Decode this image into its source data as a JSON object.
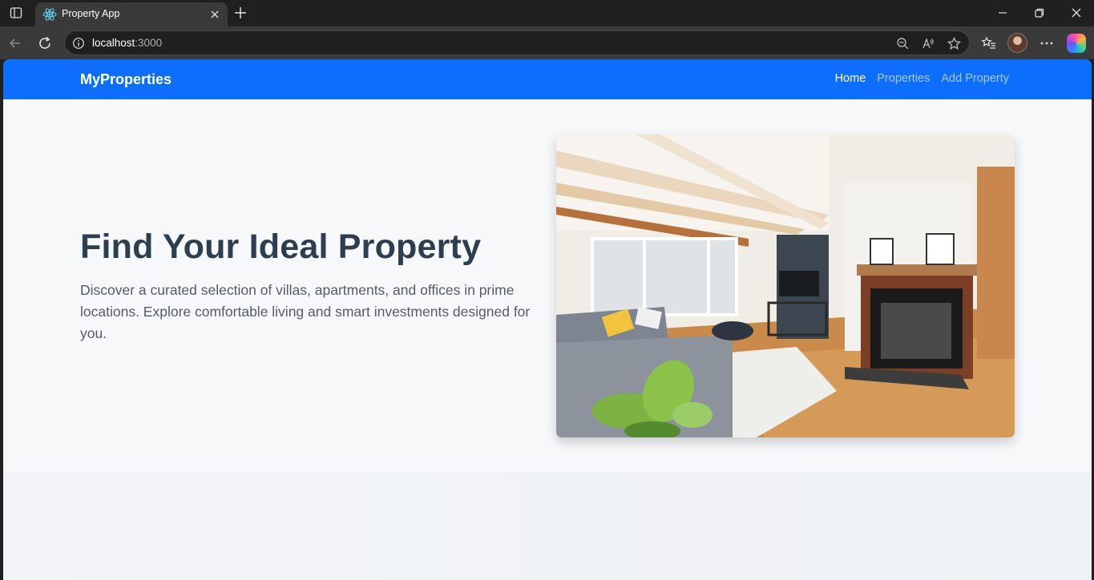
{
  "browser": {
    "tab": {
      "title": "Property App",
      "favicon": "react-icon"
    },
    "address": {
      "host": "localhost",
      "port": ":3000"
    },
    "icons": [
      "sidebar-icon",
      "close-icon",
      "new-tab-icon",
      "minimize-icon",
      "restore-icon",
      "window-close-icon",
      "back-icon",
      "reload-icon",
      "info-icon",
      "zoom-out-icon",
      "read-aloud-icon",
      "favorite-star-icon",
      "favorites-icon",
      "profile-avatar",
      "more-icon",
      "copilot-icon"
    ]
  },
  "navbar": {
    "brand": "MyProperties",
    "links": [
      {
        "label": "Home",
        "active": true
      },
      {
        "label": "Properties",
        "active": false
      },
      {
        "label": "Add Property",
        "active": false
      }
    ],
    "color": "#0d6efd"
  },
  "hero": {
    "title": "Find Your Ideal Property",
    "description": "Discover a curated selection of villas, apartments, and offices in prime locations. Explore comfortable living and smart investments designed for you."
  },
  "colors": {
    "title": "#2c3e50",
    "text": "#555c63",
    "page_bg": "#f6f8fa"
  }
}
